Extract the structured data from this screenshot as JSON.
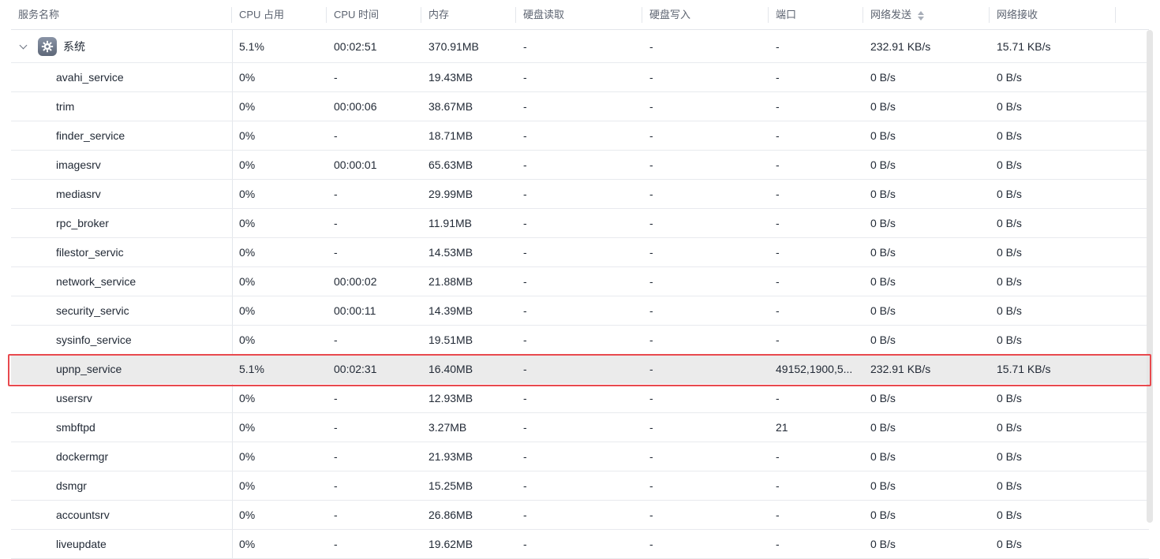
{
  "columns": {
    "name": "服务名称",
    "cpu": "CPU 占用",
    "cpu_time": "CPU 时间",
    "memory": "内存",
    "disk_read": "硬盘读取",
    "disk_write": "硬盘写入",
    "port": "端口",
    "net_send": "网络发送",
    "net_recv": "网络接收"
  },
  "group": {
    "name": "系统",
    "icon": "gear-icon",
    "cpu": "5.1%",
    "cpu_time": "00:02:51",
    "memory": "370.91MB",
    "disk_read": "-",
    "disk_write": "-",
    "port": "-",
    "net_send": "232.91 KB/s",
    "net_recv": "15.71 KB/s"
  },
  "rows": [
    {
      "name": "avahi_service",
      "cpu": "0%",
      "cpu_time": "-",
      "memory": "19.43MB",
      "disk_read": "-",
      "disk_write": "-",
      "port": "-",
      "net_send": "0 B/s",
      "net_recv": "0 B/s"
    },
    {
      "name": "trim",
      "cpu": "0%",
      "cpu_time": "00:00:06",
      "memory": "38.67MB",
      "disk_read": "-",
      "disk_write": "-",
      "port": "-",
      "net_send": "0 B/s",
      "net_recv": "0 B/s"
    },
    {
      "name": "finder_service",
      "cpu": "0%",
      "cpu_time": "-",
      "memory": "18.71MB",
      "disk_read": "-",
      "disk_write": "-",
      "port": "-",
      "net_send": "0 B/s",
      "net_recv": "0 B/s"
    },
    {
      "name": "imagesrv",
      "cpu": "0%",
      "cpu_time": "00:00:01",
      "memory": "65.63MB",
      "disk_read": "-",
      "disk_write": "-",
      "port": "-",
      "net_send": "0 B/s",
      "net_recv": "0 B/s"
    },
    {
      "name": "mediasrv",
      "cpu": "0%",
      "cpu_time": "-",
      "memory": "29.99MB",
      "disk_read": "-",
      "disk_write": "-",
      "port": "-",
      "net_send": "0 B/s",
      "net_recv": "0 B/s"
    },
    {
      "name": "rpc_broker",
      "cpu": "0%",
      "cpu_time": "-",
      "memory": "11.91MB",
      "disk_read": "-",
      "disk_write": "-",
      "port": "-",
      "net_send": "0 B/s",
      "net_recv": "0 B/s"
    },
    {
      "name": "filestor_servic",
      "cpu": "0%",
      "cpu_time": "-",
      "memory": "14.53MB",
      "disk_read": "-",
      "disk_write": "-",
      "port": "-",
      "net_send": "0 B/s",
      "net_recv": "0 B/s"
    },
    {
      "name": "network_service",
      "cpu": "0%",
      "cpu_time": "00:00:02",
      "memory": "21.88MB",
      "disk_read": "-",
      "disk_write": "-",
      "port": "-",
      "net_send": "0 B/s",
      "net_recv": "0 B/s"
    },
    {
      "name": "security_servic",
      "cpu": "0%",
      "cpu_time": "00:00:11",
      "memory": "14.39MB",
      "disk_read": "-",
      "disk_write": "-",
      "port": "-",
      "net_send": "0 B/s",
      "net_recv": "0 B/s"
    },
    {
      "name": "sysinfo_service",
      "cpu": "0%",
      "cpu_time": "-",
      "memory": "19.51MB",
      "disk_read": "-",
      "disk_write": "-",
      "port": "-",
      "net_send": "0 B/s",
      "net_recv": "0 B/s"
    },
    {
      "name": "upnp_service",
      "cpu": "5.1%",
      "cpu_time": "00:02:31",
      "memory": "16.40MB",
      "disk_read": "-",
      "disk_write": "-",
      "port": "49152,1900,5...",
      "net_send": "232.91 KB/s",
      "net_recv": "15.71 KB/s"
    },
    {
      "name": "usersrv",
      "cpu": "0%",
      "cpu_time": "-",
      "memory": "12.93MB",
      "disk_read": "-",
      "disk_write": "-",
      "port": "-",
      "net_send": "0 B/s",
      "net_recv": "0 B/s"
    },
    {
      "name": "smbftpd",
      "cpu": "0%",
      "cpu_time": "-",
      "memory": "3.27MB",
      "disk_read": "-",
      "disk_write": "-",
      "port": "21",
      "net_send": "0 B/s",
      "net_recv": "0 B/s"
    },
    {
      "name": "dockermgr",
      "cpu": "0%",
      "cpu_time": "-",
      "memory": "21.93MB",
      "disk_read": "-",
      "disk_write": "-",
      "port": "-",
      "net_send": "0 B/s",
      "net_recv": "0 B/s"
    },
    {
      "name": "dsmgr",
      "cpu": "0%",
      "cpu_time": "-",
      "memory": "15.25MB",
      "disk_read": "-",
      "disk_write": "-",
      "port": "-",
      "net_send": "0 B/s",
      "net_recv": "0 B/s"
    },
    {
      "name": "accountsrv",
      "cpu": "0%",
      "cpu_time": "-",
      "memory": "26.86MB",
      "disk_read": "-",
      "disk_write": "-",
      "port": "-",
      "net_send": "0 B/s",
      "net_recv": "0 B/s"
    },
    {
      "name": "liveupdate",
      "cpu": "0%",
      "cpu_time": "-",
      "memory": "19.62MB",
      "disk_read": "-",
      "disk_write": "-",
      "port": "-",
      "net_send": "0 B/s",
      "net_recv": "0 B/s"
    }
  ],
  "highlighted_row": "upnp_service",
  "highlight_color": "#e8494e",
  "sorted_column": "网络发送"
}
